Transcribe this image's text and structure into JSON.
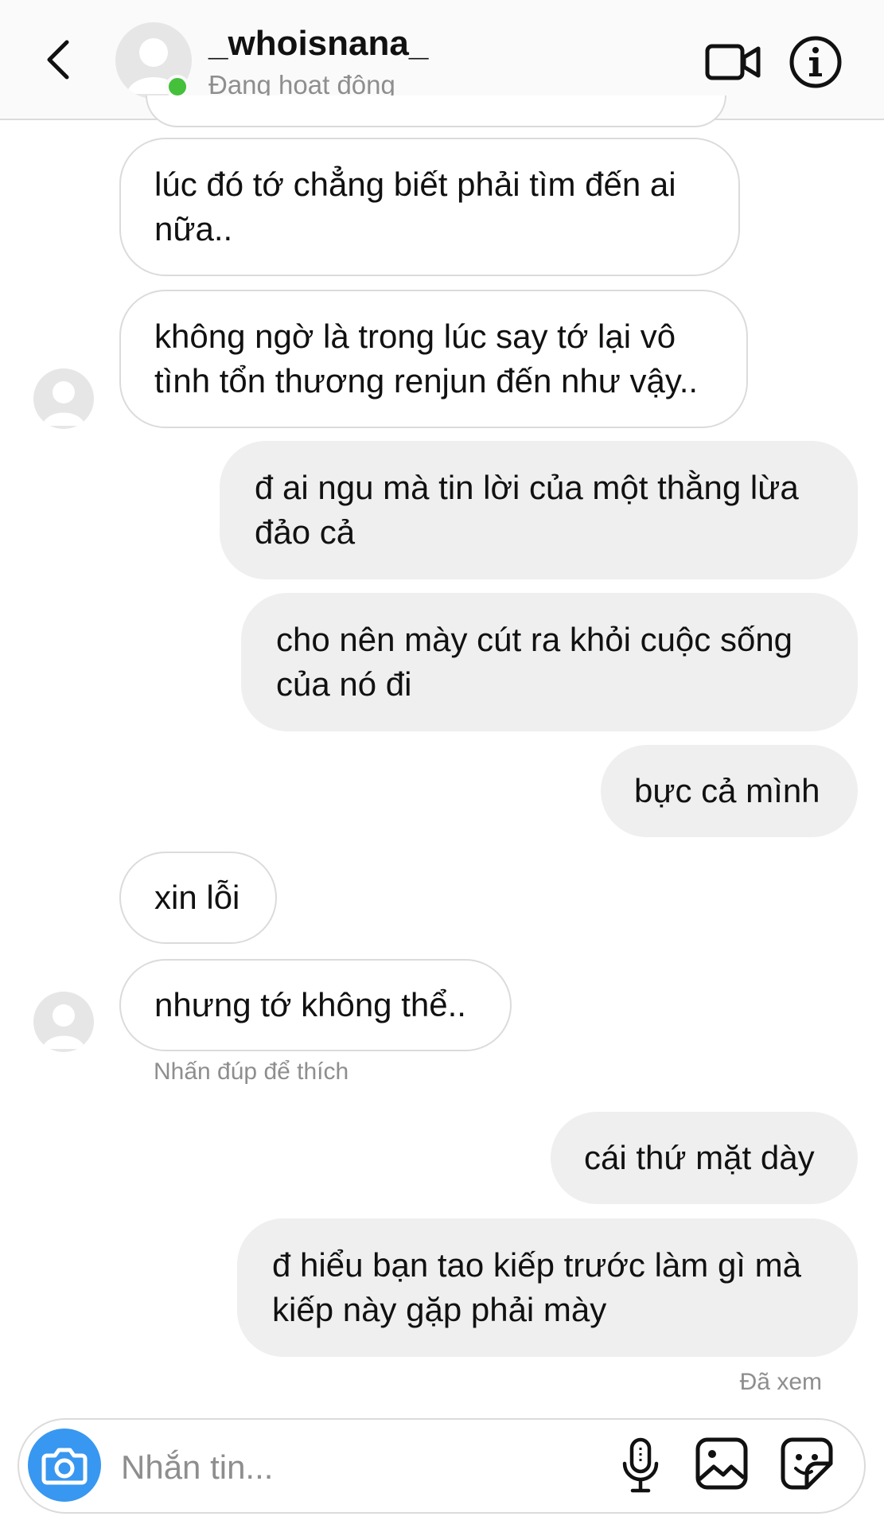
{
  "header": {
    "username": "_whoisnana_",
    "status": "Đang hoạt động"
  },
  "messages": [
    {
      "side": "in",
      "text": "lúc đó tớ chẳng biết phải tìm đến ai\nnữa.."
    },
    {
      "side": "in",
      "text": "không ngờ là trong lúc say tớ lại vô\ntình tổn thương renjun đến như vậy.."
    },
    {
      "side": "out",
      "text": "đ ai ngu mà tin lời của một thằng lừa\nđảo cả"
    },
    {
      "side": "out",
      "text": "cho nên mày cút ra khỏi cuộc sống\ncủa nó đi"
    },
    {
      "side": "out",
      "text": "bực cả mình"
    },
    {
      "side": "in",
      "text": "xin lỗi"
    },
    {
      "side": "in",
      "text": "nhưng tớ không thể.."
    },
    {
      "side": "out",
      "text": "cái thứ mặt dày"
    },
    {
      "side": "out",
      "text": "đ hiểu bạn tao kiếp trước làm gì mà\nkiếp này gặp phải mày"
    }
  ],
  "hint": "Nhấn đúp để thích",
  "seen": "Đã xem",
  "composer": {
    "placeholder": "Nhắn tin..."
  },
  "colors": {
    "accent": "#3897f0",
    "online": "#44c03a",
    "incoming_border": "#dbdbdb",
    "outgoing_bg": "#efefef",
    "muted_text": "#8e8e8e"
  }
}
